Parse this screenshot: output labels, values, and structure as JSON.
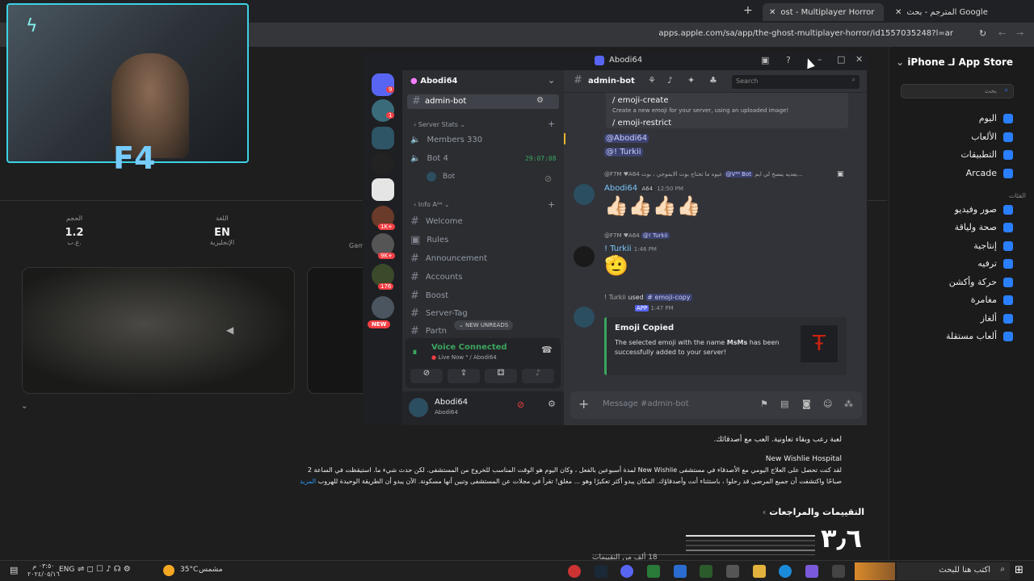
{
  "browser": {
    "tabs": [
      {
        "title": "ost - Multiplayer Horror تطبيق",
        "active": true
      },
      {
        "title": "المترجم - بحث Google",
        "active": false
      }
    ],
    "url": "apps.apple.com/sa/app/the-ghost-multiplayer-horror/id1557035248?l=ar"
  },
  "store": {
    "brand": "App Store لـ iPhone",
    "search_placeholder": "بحث",
    "nav": [
      "اليوم",
      "الألعاب",
      "التطبيقات",
      "Arcade"
    ],
    "categories_label": "الفئات",
    "categories": [
      "صور وفيديو",
      "صحة ولياقة",
      "إنتاجية",
      "ترفيه",
      "حركة وأكشن",
      "مغامرة",
      "ألغاز",
      "ألعاب مستقلة"
    ],
    "info": {
      "size_label": "الحجم",
      "size_value": "1.2",
      "size_unit": "غ.ب.",
      "lang_label": "اللغة",
      "lang_value": "EN",
      "lang_name": "الإنجليزية",
      "games_cut": "Gam"
    },
    "description_line1": "لعبة رعب وبقاء تعاونية. العب مع أصدقائك.",
    "description_title": "New Wishlie Hospital",
    "description_line2": "لقد كنت تحصل على العلاج اليومي مع الأصدقاء في مستشفى New Wishlie لمدة أسبوعين بالفعل ، وكان اليوم هو الوقت المناسب للخروج من المستشفى. لكن حدث شيء ما. استيقظت في الساعة 2",
    "description_line3": "صباحًا واكتشفت أن جميع المرضى قد رحلوا ، باستثناء أنت وأصدقاؤك. المكان يبدو أكثر تعكيرًا وهو ... مغلق! تقرأ في مجلات عن المستشفى وتبين أنها مسكونة. الآن يبدو أن الطريقة الوحيدة للهروب",
    "more_link": "المزيد",
    "ratings_title": "التقييمات والمراجعات",
    "rating_value": "٣٫٦",
    "rating_count": "18 ألف من التقييمات"
  },
  "discord": {
    "window_title": "Abodi64",
    "server_name": "Abodi64",
    "current_channel": "admin-bot",
    "search_placeholder": "Search",
    "server_badges": [
      "9",
      "1",
      "1K+",
      "9K+",
      "176"
    ],
    "new_badge": "NEW",
    "stats_category": "Server Stats",
    "members_channel": "Members 330",
    "bot_channel": "Bot 4",
    "bot_time": "29:07:08",
    "bot_user": "Bot",
    "info_category": "Info A⁶⁴",
    "channels": [
      "Welcome",
      "Rules",
      "Announcement",
      "Accounts",
      "Boost",
      "Server-Tag",
      "Partn"
    ],
    "new_unreads": "NEW UNREADS",
    "voice_status": "Voice Connected",
    "voice_sub": "Live Now ⁴ / Abodi64",
    "user_name": "Abodi64",
    "user_sub": "Abodi64",
    "message_placeholder": "Message #admin-bot",
    "cmd1": "/ emoji-create",
    "cmd1_desc": "Create a new emoji for your server, using an uploaded image!",
    "cmd2": "/ emoji-restrict",
    "mention1": "@Abodi64",
    "mention2": "@! Turkii",
    "reply1_user": "@F7M",
    "reply1_tag": "A64",
    "reply1_text": "عيوه ما تحتاج بوت الايموجي ، بوت",
    "reply1_bot": "@V⁶⁴ Bot",
    "reply1_text2": "يعديه ينسخ لي ايم...",
    "msg1_user": "Abodi64",
    "msg1_tag": "A64",
    "msg1_time": "12:50 PM",
    "msg1_emoji": "👍🏻👍🏻👍🏻👍🏻",
    "reply2_user": "@F7M",
    "reply2_tag": "A64",
    "reply2_mention": "@! Turkii",
    "msg2_user": "! Turkii",
    "msg2_time": "1:46 PM",
    "msg2_emoji": "🫡",
    "used_user": "! Turkii",
    "used_word": "used",
    "used_cmd": "# emoji-copy",
    "app_tag": "APP",
    "app_time": "1:47 PM",
    "embed_title": "Emoji Copied",
    "embed_text_a": "The selected emoji with the name",
    "embed_bold": "MsMs",
    "embed_text_b": "has been successfully added to your server!"
  },
  "taskbar": {
    "search": "اكتب هنا للبحث",
    "weather": "35°C",
    "weather_word": "مشمس",
    "lang": "ENG",
    "time": "٠٣:٥٠ م",
    "date": "٢٠٢٤/٠٥/١٦"
  }
}
